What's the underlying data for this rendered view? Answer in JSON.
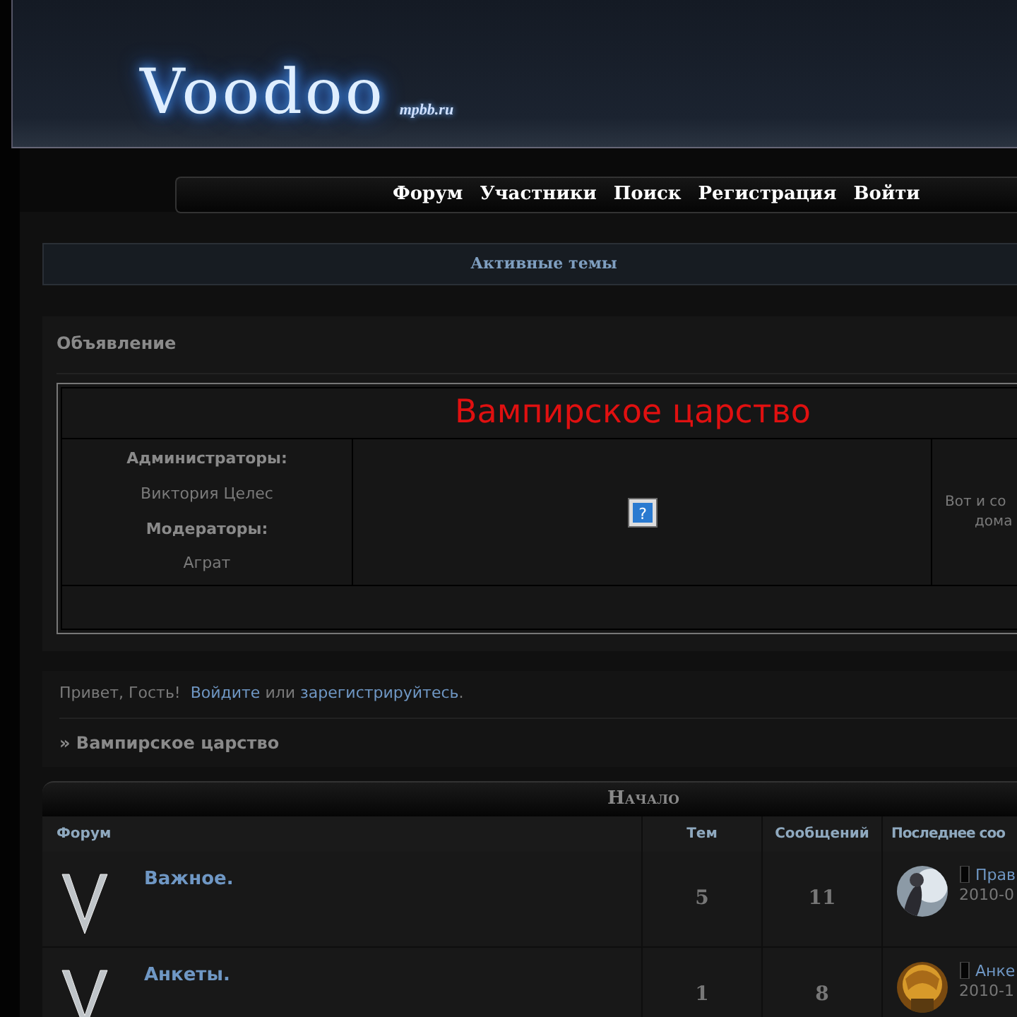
{
  "header": {
    "logo": "Voodoo",
    "site": "mpbb.ru"
  },
  "nav": [
    {
      "label": "Форум"
    },
    {
      "label": "Участники"
    },
    {
      "label": "Поиск"
    },
    {
      "label": "Регистрация"
    },
    {
      "label": "Войти"
    }
  ],
  "active_topics": "Активные темы",
  "announcement": {
    "heading": "Объявление",
    "title": "Вампирское царство",
    "staff": [
      {
        "kind": "role",
        "text": "Администраторы:"
      },
      {
        "kind": "name",
        "text": "Виктория Целес"
      },
      {
        "kind": "role",
        "text": "Модераторы:"
      },
      {
        "kind": "name",
        "text": "Аграт"
      }
    ],
    "image_mark": "?",
    "side_text": [
      "Вот и со",
      "дома"
    ]
  },
  "welcome": {
    "greeting": "Привет, Гость!",
    "login": "Войдите",
    "or": "или",
    "register": "зарегистрируйтесь",
    "end": "."
  },
  "breadcrumb": "» Вампирское царство",
  "category": {
    "title": "Начало",
    "columns": [
      "Форум",
      "Тем",
      "Сообщений",
      "Последнее соо"
    ],
    "rows": [
      {
        "name": "Важное.",
        "topics": "5",
        "posts": "11",
        "last_topic": "Прав",
        "last_date": "2010-0"
      },
      {
        "name": "Анкеты.",
        "topics": "1",
        "posts": "8",
        "last_topic": "Анке",
        "last_date": "2010-1"
      }
    ]
  }
}
